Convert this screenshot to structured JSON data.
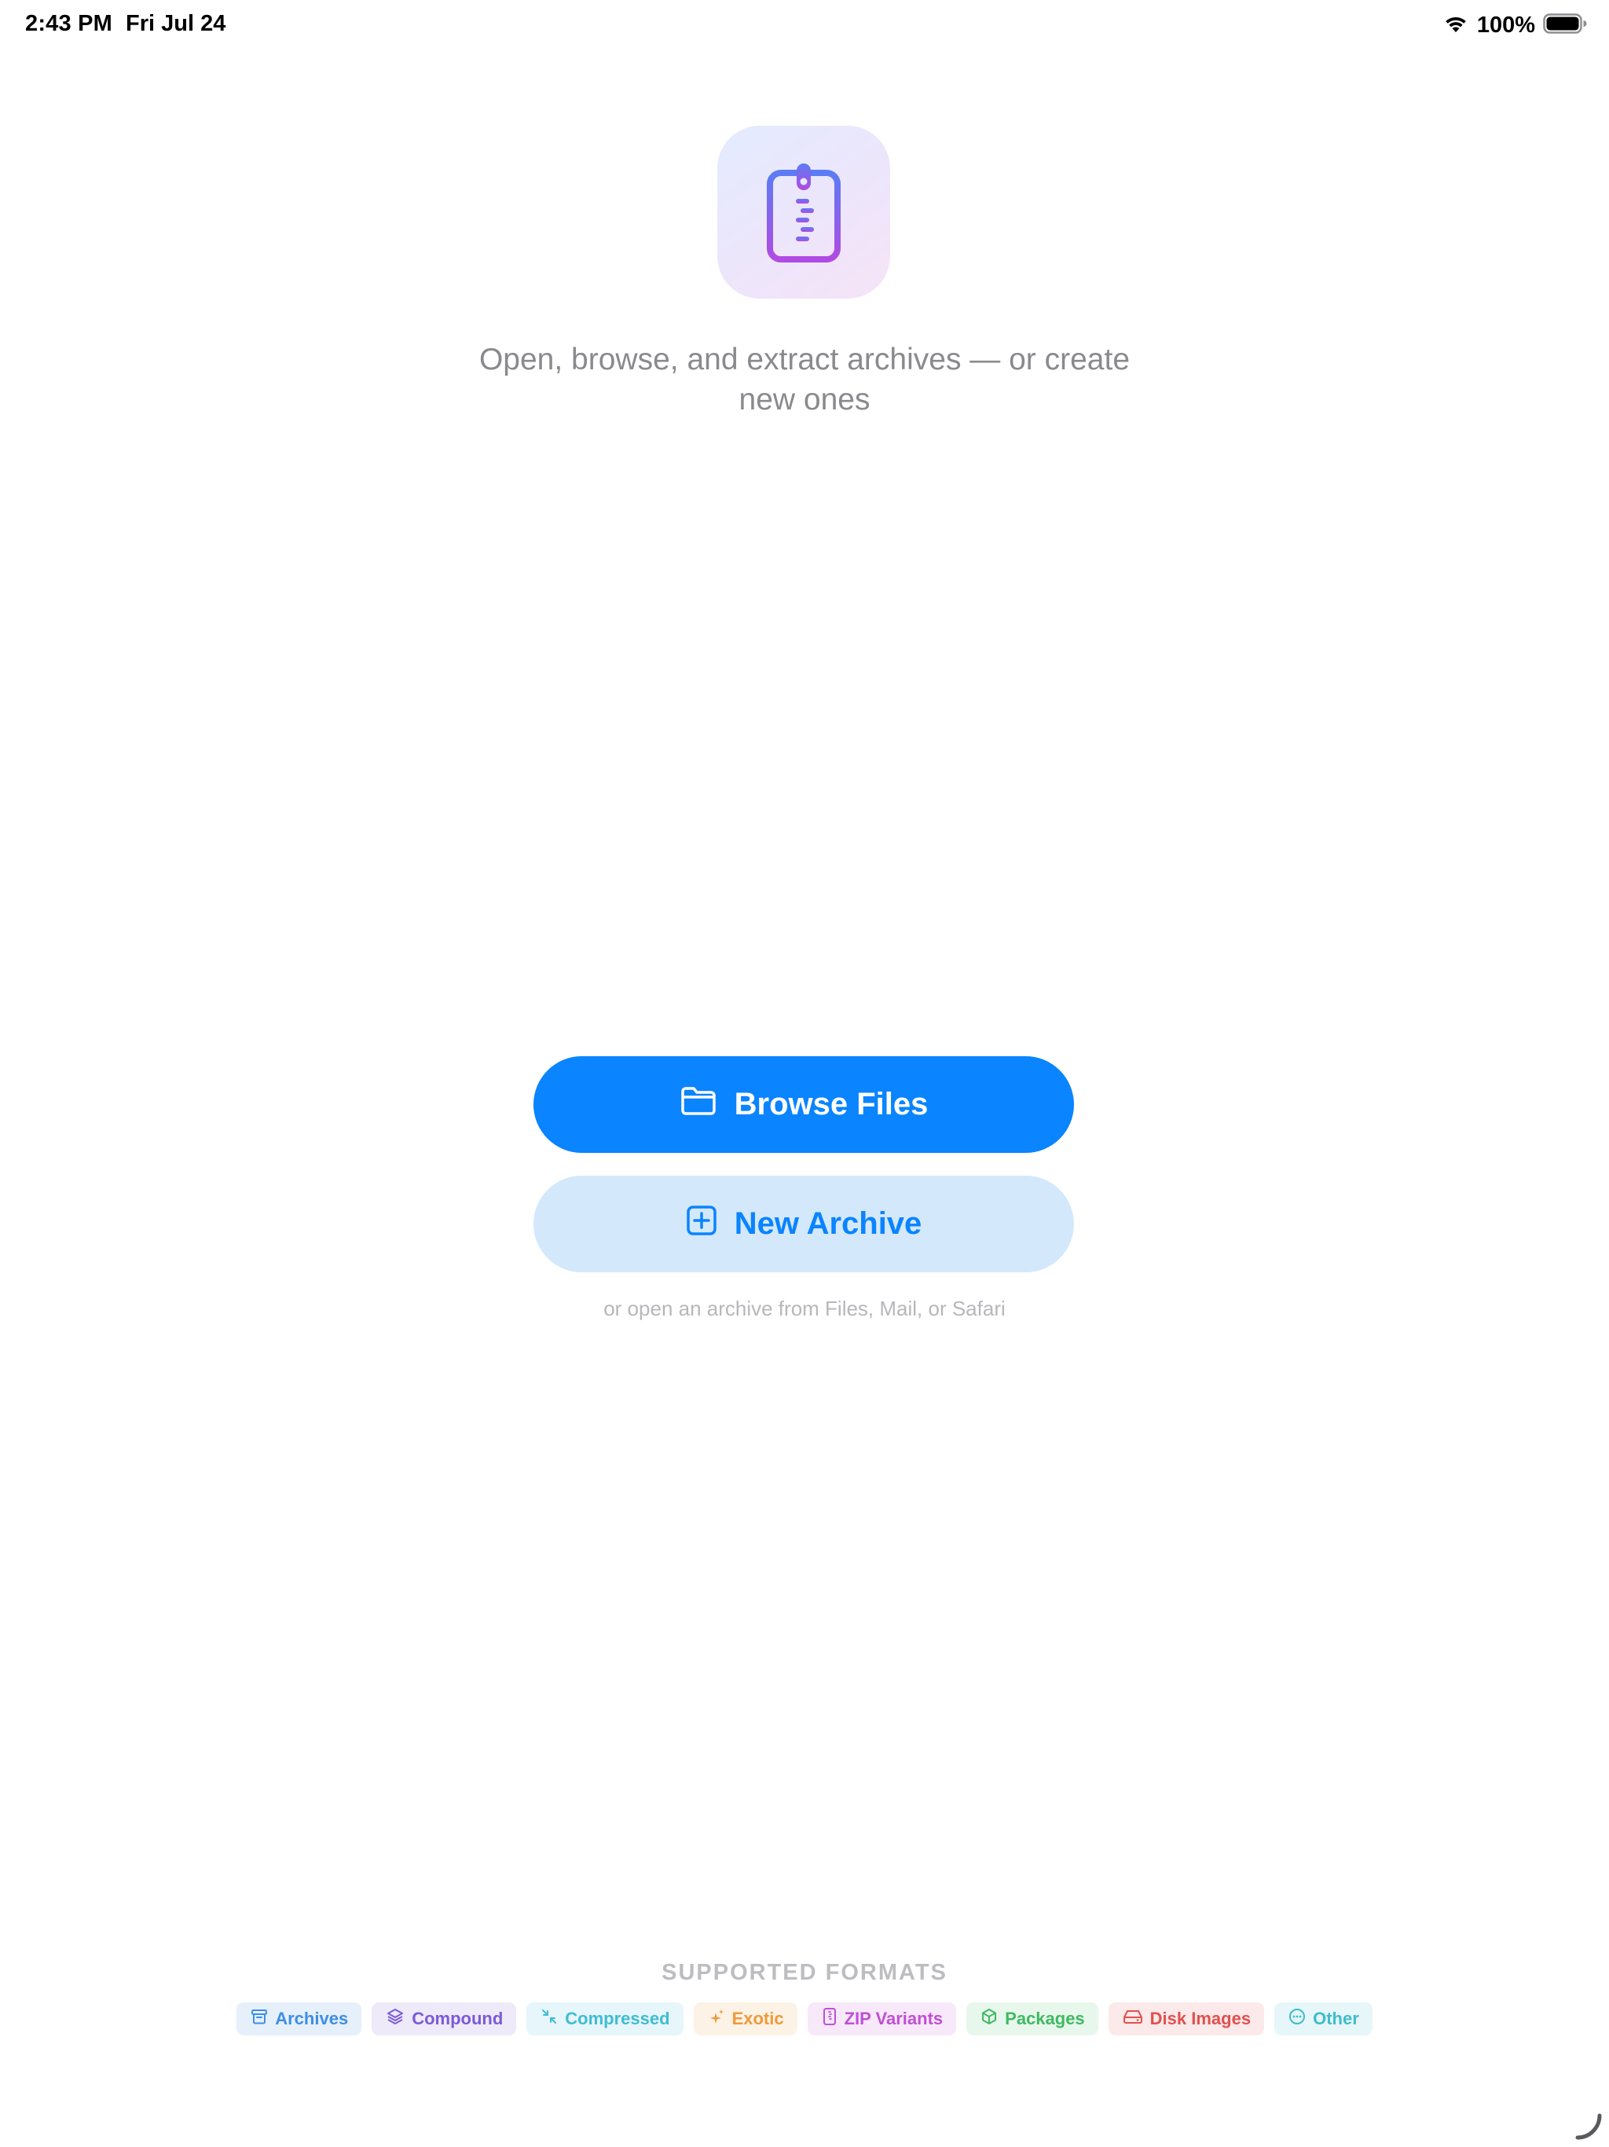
{
  "status_bar": {
    "time": "2:43 PM",
    "date": "Fri Jul 24",
    "battery": "100%"
  },
  "main": {
    "tagline_line1": "Open, browse, and extract archives — or create",
    "tagline_line2": "new ones",
    "browse_label": "Browse Files",
    "new_archive_label": "New Archive",
    "hint": "or open an archive from Files, Mail, or Safari"
  },
  "formats": {
    "title": "SUPPORTED FORMATS",
    "chips": [
      {
        "label": "Archives",
        "icon": "archivebox-icon",
        "color": "#3d8ee6",
        "bg": "#e6f0fb"
      },
      {
        "label": "Compound",
        "icon": "layers-icon",
        "color": "#7a5ad9",
        "bg": "#eeeaf9"
      },
      {
        "label": "Compressed",
        "icon": "compress-arrows-icon",
        "color": "#3fbcd4",
        "bg": "#e6f6fa"
      },
      {
        "label": "Exotic",
        "icon": "sparkles-icon",
        "color": "#ef9a3a",
        "bg": "#fdf2e6"
      },
      {
        "label": "ZIP Variants",
        "icon": "zipper-doc-icon",
        "color": "#c04fd6",
        "bg": "#f7e8fa"
      },
      {
        "label": "Packages",
        "icon": "cube-icon",
        "color": "#3fba62",
        "bg": "#e8f7ec"
      },
      {
        "label": "Disk Images",
        "icon": "drive-icon",
        "color": "#e0514f",
        "bg": "#fce9e9"
      },
      {
        "label": "Other",
        "icon": "ellipsis-circle-icon",
        "color": "#3fbccb",
        "bg": "#e6f6f9"
      }
    ]
  },
  "colors": {
    "accent": "#0a84ff",
    "accent_light": "#d4e8fc",
    "secondary_text": "#8a8a8e"
  }
}
